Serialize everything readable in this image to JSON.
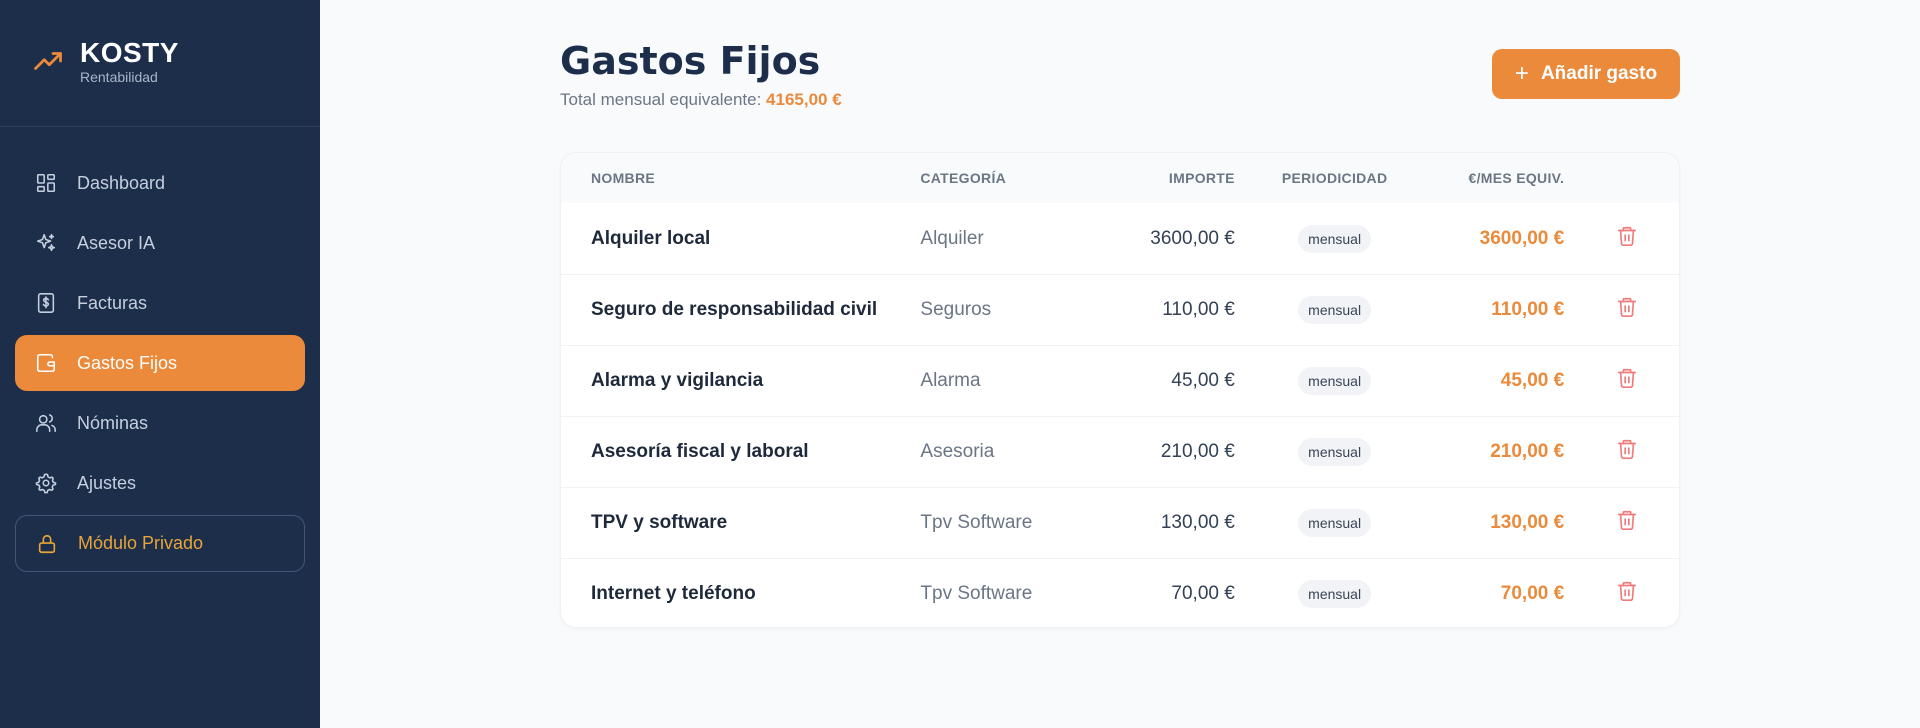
{
  "brand": {
    "title": "KOSTY",
    "subtitle": "Rentabilidad"
  },
  "sidebar": {
    "items": [
      {
        "label": "Dashboard",
        "icon": "dashboard-grid-icon"
      },
      {
        "label": "Asesor IA",
        "icon": "sparkles-icon"
      },
      {
        "label": "Facturas",
        "icon": "invoice-icon"
      },
      {
        "label": "Gastos Fijos",
        "icon": "wallet-icon",
        "active": true
      },
      {
        "label": "Nóminas",
        "icon": "users-icon"
      },
      {
        "label": "Ajustes",
        "icon": "gear-icon"
      },
      {
        "label": "Módulo Privado",
        "icon": "lock-icon"
      }
    ]
  },
  "header": {
    "title": "Gastos Fijos",
    "subtitle_label": "Total mensual equivalente:",
    "subtitle_total": "4165,00 €",
    "add_button": "Añadir gasto"
  },
  "table": {
    "columns": [
      "NOMBRE",
      "CATEGORÍA",
      "IMPORTE",
      "PERIODICIDAD",
      "€/MES EQUIV."
    ],
    "rows": [
      {
        "name": "Alquiler local",
        "category": "Alquiler",
        "amount": "3600,00 €",
        "period": "mensual",
        "monthly": "3600,00 €"
      },
      {
        "name": "Seguro de responsabilidad civil",
        "category": "Seguros",
        "amount": "110,00 €",
        "period": "mensual",
        "monthly": "110,00 €"
      },
      {
        "name": "Alarma y vigilancia",
        "category": "Alarma",
        "amount": "45,00 €",
        "period": "mensual",
        "monthly": "45,00 €"
      },
      {
        "name": "Asesoría fiscal y laboral",
        "category": "Asesoria",
        "amount": "210,00 €",
        "period": "mensual",
        "monthly": "210,00 €"
      },
      {
        "name": "TPV y software",
        "category": "Tpv Software",
        "amount": "130,00 €",
        "period": "mensual",
        "monthly": "130,00 €"
      },
      {
        "name": "Internet y teléfono",
        "category": "Tpv Software",
        "amount": "70,00 €",
        "period": "mensual",
        "monthly": "70,00 €"
      }
    ]
  },
  "colors": {
    "sidebar_bg": "#1c2e4a",
    "accent": "#ea8a3a",
    "private_text": "#e7a43a",
    "delete_icon": "#ef7b7b"
  }
}
